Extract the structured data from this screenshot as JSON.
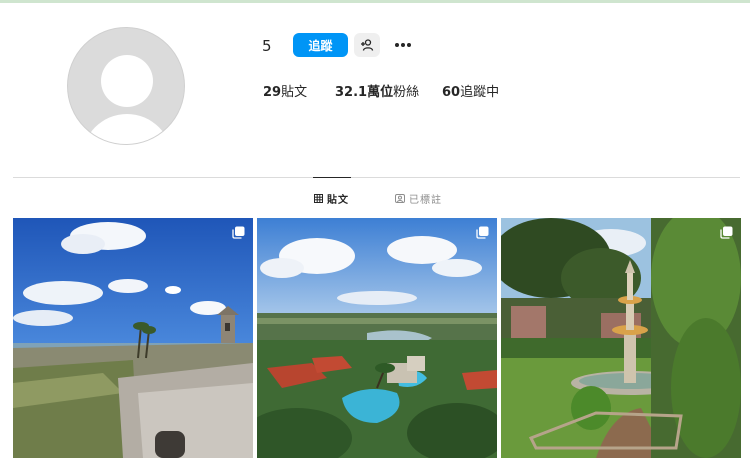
{
  "profile": {
    "username": "5",
    "follow_label": "追蹤",
    "stats": {
      "posts": {
        "count": "29",
        "label": "貼文"
      },
      "followers": {
        "count": "32.1萬位",
        "label": "粉絲"
      },
      "following": {
        "count": "60",
        "label": "追蹤中"
      }
    }
  },
  "tabs": [
    {
      "label": "貼文",
      "icon": "grid-icon",
      "active": true
    },
    {
      "label": "已標註",
      "icon": "tagged-icon",
      "active": false
    }
  ],
  "posts": [
    {
      "subject": "fort-lookout-tower",
      "multi": true
    },
    {
      "subject": "resort-pool-aerial",
      "multi": true
    },
    {
      "subject": "garden-fountain",
      "multi": true
    }
  ],
  "colors": {
    "accent": "#0095f6",
    "text": "#262626",
    "muted": "#8e8e8e",
    "divider": "#dbdbdb"
  }
}
